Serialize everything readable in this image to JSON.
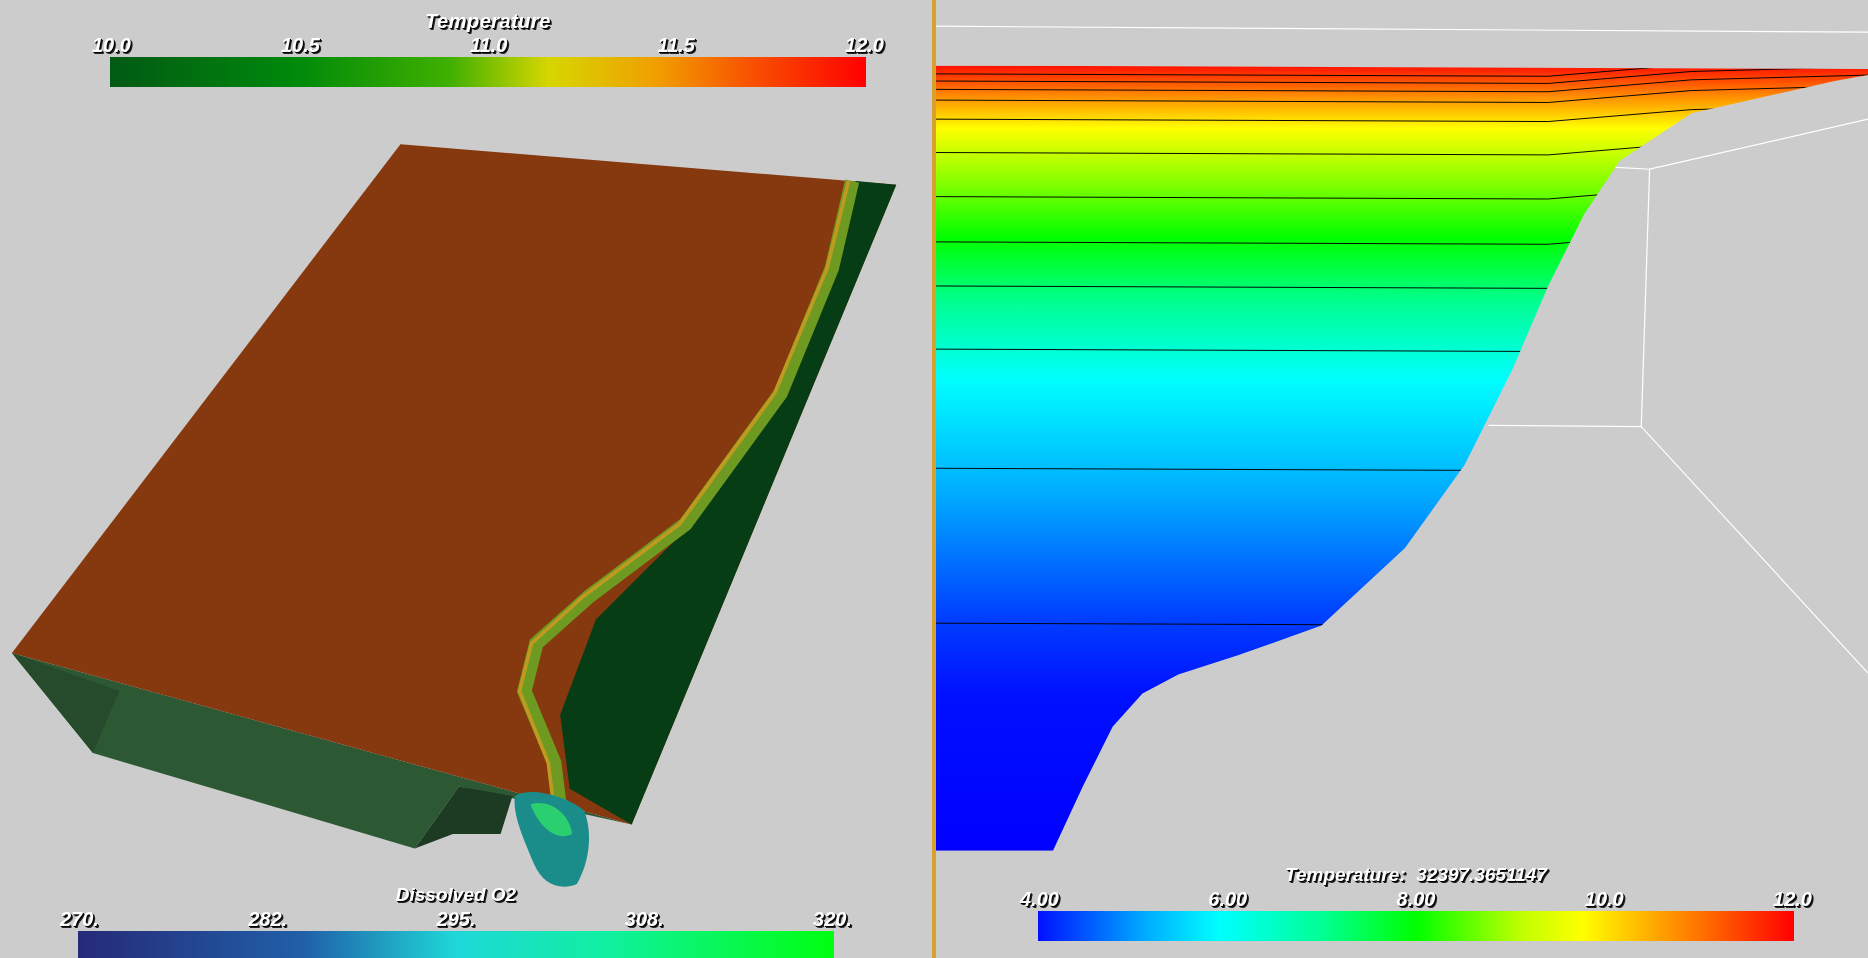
{
  "views": [
    {
      "kind": "volume",
      "scalar_bars": [
        {
          "title": "Temperature",
          "ticks": [
            "10.0",
            "10.5",
            "11.0",
            "11.5",
            "12.0"
          ]
        },
        {
          "title": "Dissolved O2",
          "ticks": [
            "270.",
            "282.",
            "295.",
            "308.",
            "320."
          ]
        }
      ]
    },
    {
      "kind": "cross-section",
      "scalar_bars": [
        {
          "title": "Temperature:  32397.3651147",
          "ticks": [
            "4.00",
            "6.00",
            "8.00",
            "10.0",
            "12.0"
          ]
        }
      ]
    }
  ]
}
